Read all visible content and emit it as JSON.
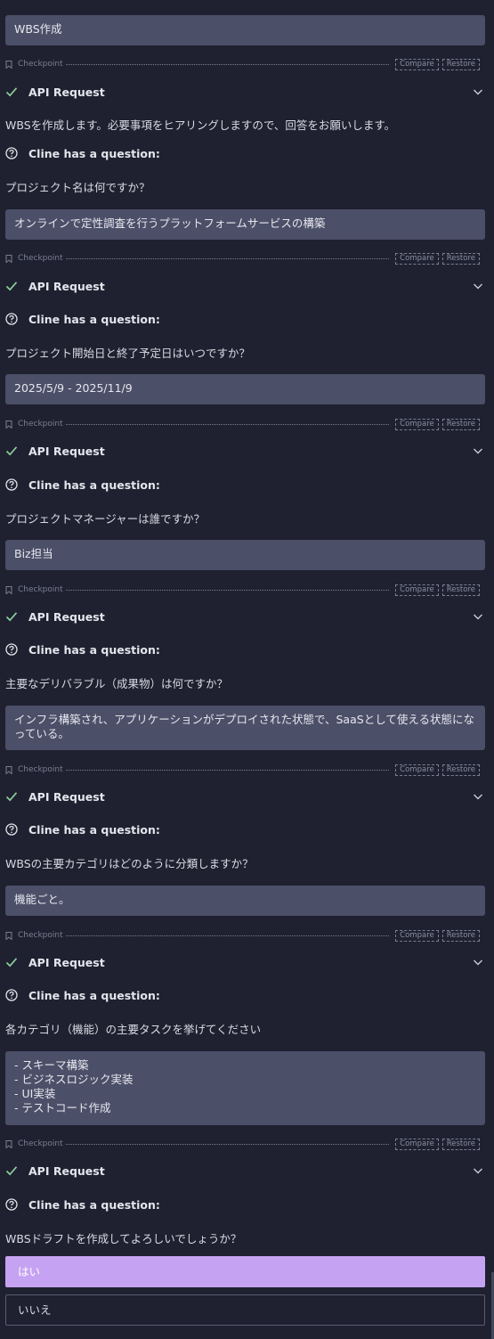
{
  "colors": {
    "background": "#1f2130",
    "user_bubble": "#4c4f68",
    "selected_option": "#c6a3f2"
  },
  "checkpoint": {
    "label": "Checkpoint",
    "compare": "Compare",
    "restore": "Restore"
  },
  "api_request_label": "API Request",
  "question_label": "Cline has a question:",
  "messages": {
    "m0": "WBS作成",
    "m1": "オンラインで定性調査を行うプラットフォームサービスの構築",
    "m2": "2025/5/9 - 2025/11/9",
    "m3": "Biz担当",
    "m4": "インフラ構築され、アプリケーションがデプロイされた状態で、SaaSとして使える状態になっている。",
    "m5": "機能ごと。",
    "m6": "- スキーマ構築\n- ビジネスロジック実装\n- UI実装\n- テストコード作成"
  },
  "intro": "WBSを作成します。必要事項をヒアリングしますので、回答をお願いします。",
  "questions": {
    "q1": "プロジェクト名は何ですか？",
    "q2": "プロジェクト開始日と終了予定日はいつですか？",
    "q3": "プロジェクトマネージャーは誰ですか？",
    "q4": "主要なデリバラブル（成果物）は何ですか？",
    "q5": "WBSの主要カテゴリはどのように分類しますか？",
    "q6": "各カテゴリ（機能）の主要タスクを挙げてください",
    "q7": "WBSドラフトを作成してよろしいでしょうか？"
  },
  "options": {
    "yes": "はい",
    "no": "いいえ"
  }
}
